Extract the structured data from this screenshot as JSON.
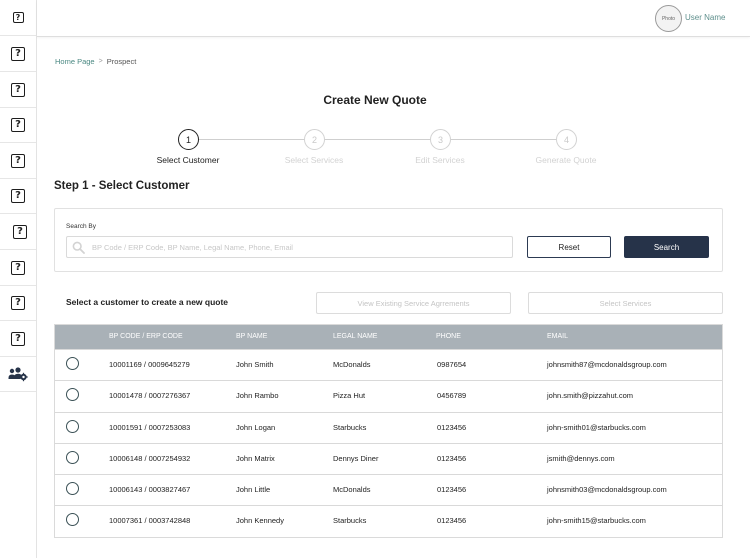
{
  "sidebar": {
    "items": [
      {
        "icon": "question-icon"
      },
      {
        "icon": "question-icon"
      },
      {
        "icon": "question-icon"
      },
      {
        "icon": "question-icon"
      },
      {
        "icon": "question-icon"
      },
      {
        "icon": "question-icon"
      },
      {
        "icon": "question-icon"
      },
      {
        "icon": "question-icon"
      },
      {
        "icon": "question-icon"
      },
      {
        "icon": "question-icon"
      },
      {
        "icon": "team-settings-icon"
      }
    ]
  },
  "header": {
    "avatar_label": "Photo",
    "user_name": "User Name"
  },
  "breadcrumb": {
    "home": "Home Page",
    "separator": ">",
    "current": "Prospect"
  },
  "page": {
    "title": "Create New Quote"
  },
  "stepper": {
    "steps": [
      {
        "number": "1",
        "label": "Select Customer",
        "active": true
      },
      {
        "number": "2",
        "label": "Select Services",
        "active": false
      },
      {
        "number": "3",
        "label": "Edit Services",
        "active": false
      },
      {
        "number": "4",
        "label": "Generate Quote",
        "active": false
      }
    ]
  },
  "section": {
    "title": "Step 1 - Select Customer"
  },
  "search": {
    "label": "Search By",
    "placeholder": "BP Code / ERP Code, BP Name, Legal Name, Phone, Email",
    "value": "",
    "reset_label": "Reset",
    "search_label": "Search"
  },
  "actions": {
    "prompt": "Select a customer to create a new quote",
    "view_agreements_label": "View Existing Service Agrrements",
    "select_services_label": "Select Services"
  },
  "table": {
    "columns": [
      "BP CODE / ERP CODE",
      "BP NAME",
      "LEGAL NAME",
      "PHONE",
      "EMAIL"
    ],
    "rows": [
      [
        "10001169 / 0009645279",
        "John Smith",
        "McDonalds",
        "0987654",
        "johnsmith87@mcdonaldsgroup.com"
      ],
      [
        "10001478 / 0007276367",
        "John Rambo",
        "Pizza Hut",
        "0456789",
        "john.smith@pizzahut.com"
      ],
      [
        "10001591 / 0007253083",
        "John Logan",
        "Starbucks",
        "0123456",
        "john-smith01@starbucks.com"
      ],
      [
        "10006148 / 0007254932",
        "John Matrix",
        "Dennys Diner",
        "0123456",
        "jsmith@dennys.com"
      ],
      [
        "10006143 / 0003827467",
        "John Little",
        "McDonalds",
        "0123456",
        "johnsmith03@mcdonaldsgroup.com"
      ],
      [
        "10007361 / 0003742848",
        "John Kennedy",
        "Starbucks",
        "0123456",
        "john-smith15@starbucks.com"
      ]
    ]
  },
  "colors": {
    "accent": "#263349",
    "link": "#4a8882",
    "table_header": "#a9b1b7"
  }
}
